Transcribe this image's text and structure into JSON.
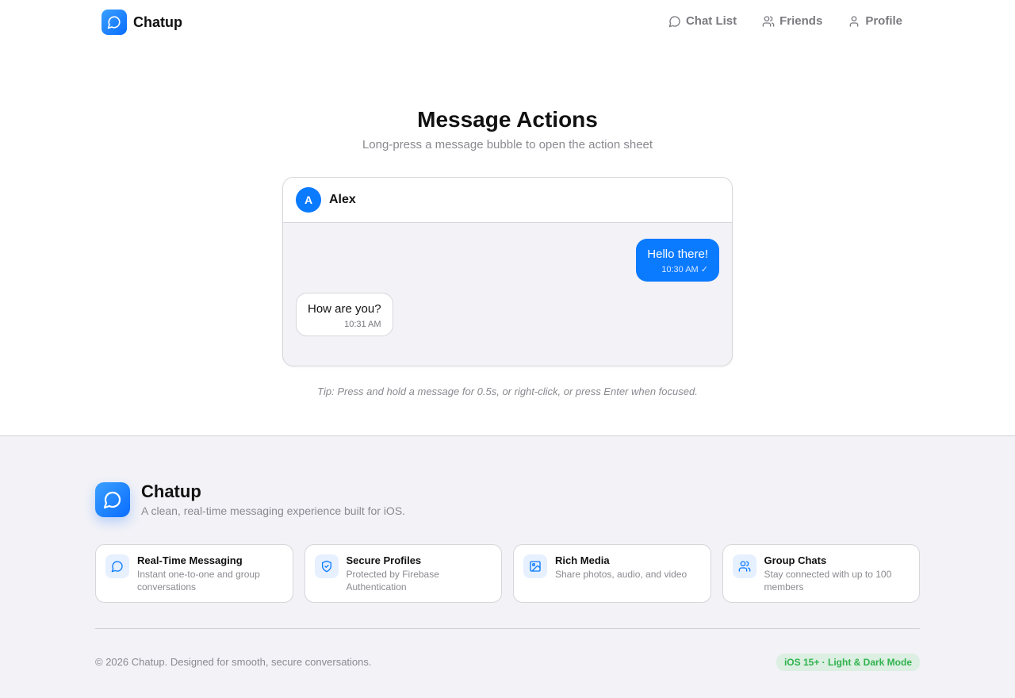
{
  "header": {
    "brand": "Chatup",
    "nav": [
      {
        "label": "Chat List",
        "icon": "chat-bubble-icon"
      },
      {
        "label": "Friends",
        "icon": "users-icon"
      },
      {
        "label": "Profile",
        "icon": "user-icon"
      }
    ]
  },
  "hero": {
    "title": "Message Actions",
    "subtitle": "Long-press a message bubble to open the action sheet"
  },
  "chat": {
    "contact_initial": "A",
    "contact_name": "Alex",
    "messages": [
      {
        "direction": "outgoing",
        "text": "Hello there!",
        "time": "10:30 AM",
        "status": "✓"
      },
      {
        "direction": "incoming",
        "text": "How are you?",
        "time": "10:31 AM"
      }
    ]
  },
  "tip": "Tip: Press and hold a message for 0.5s, or right-click, or press Enter when focused.",
  "footer": {
    "brand": "Chatup",
    "tagline": "A clean, real-time messaging experience built for iOS.",
    "features": [
      {
        "title": "Real-Time Messaging",
        "desc": "Instant one-to-one and group conversations",
        "icon": "chat-bubble-icon"
      },
      {
        "title": "Secure Profiles",
        "desc": "Protected by Firebase Authentication",
        "icon": "shield-check-icon"
      },
      {
        "title": "Rich Media",
        "desc": "Share photos, audio, and video",
        "icon": "image-icon"
      },
      {
        "title": "Group Chats",
        "desc": "Stay connected with up to 100 members",
        "icon": "users-icon"
      }
    ],
    "copyright": "© 2026 Chatup. Designed for smooth, secure conversations.",
    "badge": "iOS 15+ · Light & Dark Mode"
  },
  "colors": {
    "accent": "#0a7aff",
    "badge_text": "#2fb24d",
    "badge_bg": "#dcefe2"
  }
}
